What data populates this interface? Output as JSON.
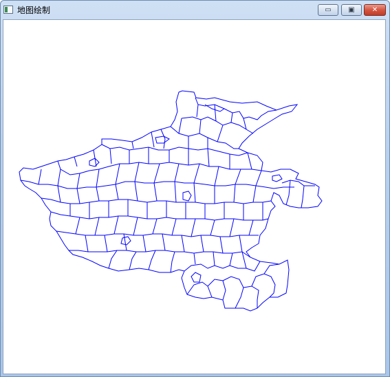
{
  "window": {
    "title": "地图绘制",
    "app_icon": "app-window-icon",
    "controls": {
      "minimize_icon": "minimize-icon",
      "minimize_glyph": "▭",
      "maximize_icon": "maximize-icon",
      "maximize_glyph": "▣",
      "close_icon": "close-icon",
      "close_glyph": "✕"
    }
  },
  "colors": {
    "map_stroke": "#0000ff",
    "canvas_background": "#ffffff",
    "close_button": "#c03c29"
  }
}
